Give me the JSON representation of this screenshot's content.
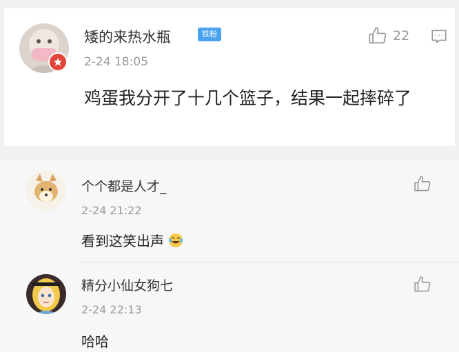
{
  "main_comment": {
    "user_name": "矮的来热水瓶",
    "fan_badge": "铁粉",
    "time": "2-24 18:05",
    "content": "鸡蛋我分开了十几个篮子，结果一起摔碎了",
    "like_count": "22",
    "avatar_icon": "avatar-pink-mask",
    "badge_icon": "verified-badge"
  },
  "replies": [
    {
      "user_name": "个个都是人才_",
      "time": "2-24 21:22",
      "content": "看到这笑出声",
      "emoji": "laughing-tears-emoji",
      "avatar_icon": "avatar-shiba-dog"
    },
    {
      "user_name": "精分小仙女狗七",
      "time": "2-24 22:13",
      "content": "哈哈",
      "avatar_icon": "avatar-alice-cartoon"
    }
  ],
  "colors": {
    "accent_blue": "#4aa3f0",
    "badge_red": "#e3453a",
    "muted": "#999999"
  }
}
